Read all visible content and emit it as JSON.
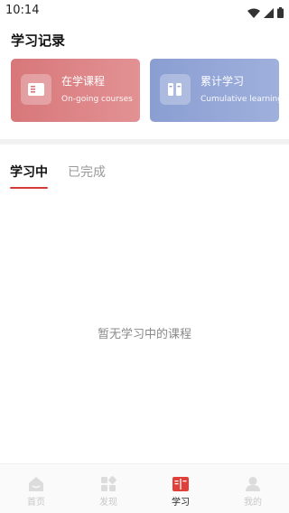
{
  "status": {
    "time": "10:14",
    "icons": [
      "wifi-icon",
      "signal-icon",
      "battery-icon"
    ]
  },
  "page": {
    "section_title": "学习记录"
  },
  "cards": {
    "ongoing": {
      "title": "在学课程",
      "subtitle": "On-going courses",
      "icon": "book-icon",
      "color": "#d8777a"
    },
    "cumulative": {
      "title": "累计学习",
      "subtitle": "Cumulative learning",
      "icon": "books-icon",
      "color": "#8a9ed2"
    }
  },
  "tabs": [
    {
      "label": "学习中",
      "active": true
    },
    {
      "label": "已完成",
      "active": false
    }
  ],
  "empty_state": {
    "text": "暂无学习中的课程"
  },
  "nav": {
    "items": [
      {
        "label": "首页",
        "icon": "home-icon",
        "active": false
      },
      {
        "label": "发现",
        "icon": "discover-icon",
        "active": false
      },
      {
        "label": "学习",
        "icon": "learn-book-icon",
        "active": true
      },
      {
        "label": "我的",
        "icon": "profile-icon",
        "active": false
      }
    ]
  },
  "colors": {
    "accent": "#d33a3a",
    "active_nav_icon": "#e0403a",
    "inactive_nav": "#c8c8c8"
  }
}
